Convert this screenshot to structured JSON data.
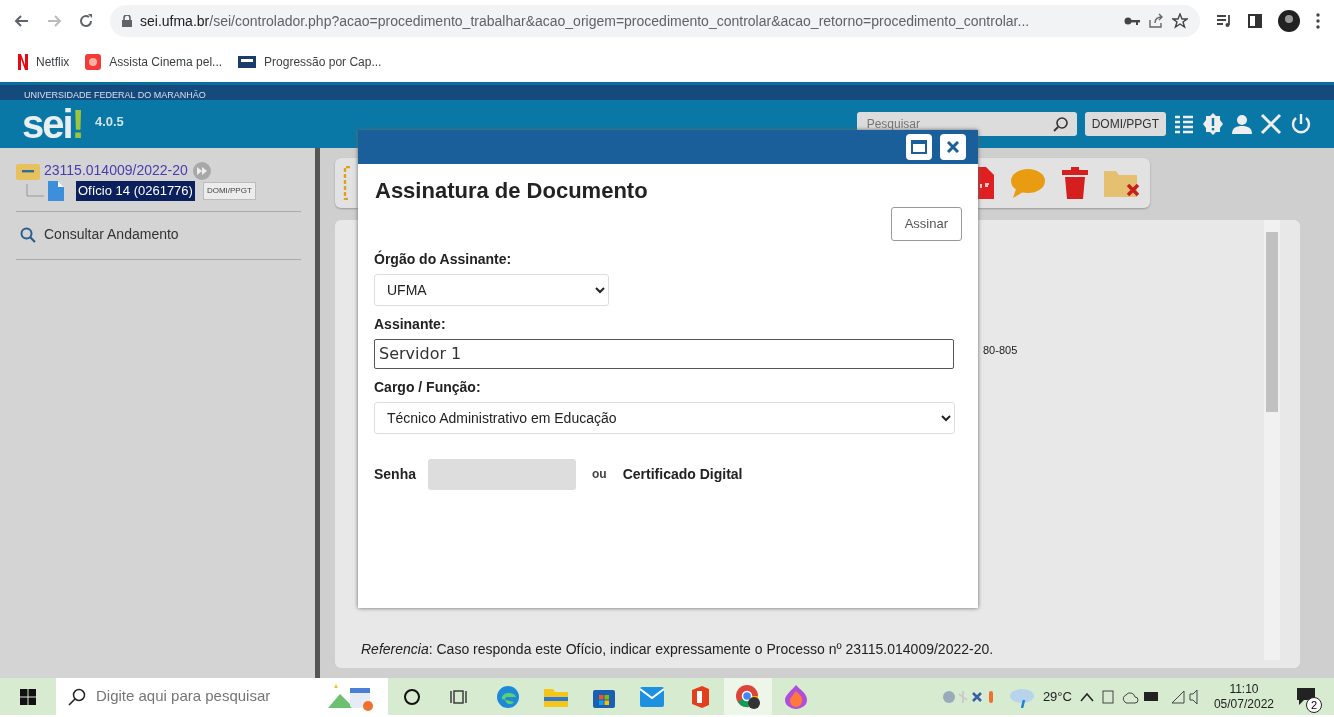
{
  "browser": {
    "url_host": "sei.ufma.br",
    "url_path": "/sei/controlador.php?acao=procedimento_trabalhar&acao_origem=procedimento_controlar&acao_retorno=procedimento_controlar...",
    "bookmarks": [
      {
        "label": "Netflix",
        "kind": "netflix"
      },
      {
        "label": "Assista Cinema pel...",
        "kind": "globo"
      },
      {
        "label": "Progressão por Cap...",
        "kind": "ufpr"
      }
    ]
  },
  "header": {
    "institution": "UNIVERSIDADE FEDERAL DO MARANHÃO",
    "logo": "sei",
    "logo_mark": "!",
    "version": "4.0.5",
    "search": {
      "placeholder": "Pesquisar"
    },
    "unit": "DOMI/PPGT"
  },
  "tree": {
    "process": "23115.014009/2022-20",
    "children": [
      {
        "label": "Ofício 14 (0261776)",
        "selected": true,
        "tag": "DOMI/PPGT"
      }
    ]
  },
  "sidebar_items": [
    "Consultar Andamento"
  ],
  "document": {
    "fragment": "80-805",
    "reference": "*Referencia*: Caso responda este Ofício, indicar expressamente o Processo nº 23115.014009/2022-20."
  },
  "dialog": {
    "title": "Assinatura de Documento",
    "sign_button": "Assinar",
    "org_label": "Órgão do Assinante:",
    "org_value": "UFMA",
    "signer_label": "Assinante:",
    "signer_value": "Servidor 1",
    "role_label": "Cargo / Função:",
    "role_value": "Técnico Administrativo em Educação",
    "password_label": "Senha",
    "or": "ou",
    "certificate": "Certificado Digital"
  },
  "taskbar": {
    "search": {
      "placeholder": "Digite aqui para pesquisar"
    },
    "apps": [
      {
        "kind": "cortana",
        "active": false
      },
      {
        "kind": "taskview",
        "active": false
      },
      {
        "kind": "edge",
        "active": false
      },
      {
        "kind": "explorer",
        "active": false
      },
      {
        "kind": "store",
        "active": false
      },
      {
        "kind": "mail",
        "active": false
      },
      {
        "kind": "office",
        "active": false
      },
      {
        "kind": "chrome",
        "active": true
      },
      {
        "kind": "firefox",
        "active": false
      }
    ],
    "temperature": "29°C",
    "time": "11:10",
    "date": "05/07/2022",
    "notifications": "2"
  }
}
